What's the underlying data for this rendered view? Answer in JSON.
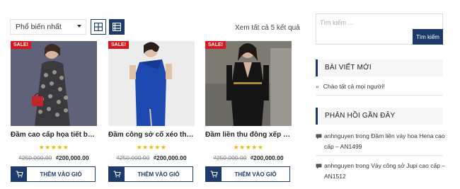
{
  "toolbar": {
    "sort_value": "Phổ biến nhất",
    "result_count": "Xem tất cả 5 kết quả"
  },
  "products": [
    {
      "sale_label": "SALE!",
      "title": "Đầm cao cấp họa tiết bông lúa",
      "rating": "★★★★★",
      "old_price": "₫250,000.00",
      "new_price": "₫200,000.00",
      "cart_label": "THÊM VÀO GIỎ"
    },
    {
      "sale_label": "SALE!",
      "title": "Đầm công sở cổ xéo thời trang",
      "rating": "★★★★★",
      "old_price": "₫250,000.00",
      "new_price": "₫200,000.00",
      "cart_label": "THÊM VÀO GIỎ"
    },
    {
      "sale_label": "SALE!",
      "title": "Đầm liền thu đông xếp tà fashion",
      "rating": "★★★★★",
      "old_price": "₫250,000.00",
      "new_price": "₫200,000.00",
      "cart_label": "THÊM VÀO GIỎ"
    }
  ],
  "sidebar": {
    "search_placeholder": "Tìm kiếm …",
    "search_button": "Tìm kiếm",
    "recent_posts_title": "BÀI VIẾT MỚI",
    "recent_posts": [
      {
        "title": "Chào tất cả mọi người!"
      }
    ],
    "recent_comments_title": "PHẢN HỒI GẦN ĐÂY",
    "recent_comments": [
      {
        "author": "anhnguyen",
        "connector": "trong",
        "post": "Đầm liền váy hoa Hena cao cấp – AN1499"
      },
      {
        "author": "anhnguyen",
        "connector": "trong",
        "post": "Váy công sở Jupi cao cấp – AN1512"
      }
    ]
  },
  "colors": {
    "primary": "#1d3a6b",
    "sale": "#d9171c",
    "star": "#f2b705"
  },
  "icons": {
    "grid_view": "grid-view-icon",
    "list_view": "list-view-icon",
    "cart": "cart-icon",
    "comment": "comment-icon",
    "bullet": "angle-right-icon"
  }
}
